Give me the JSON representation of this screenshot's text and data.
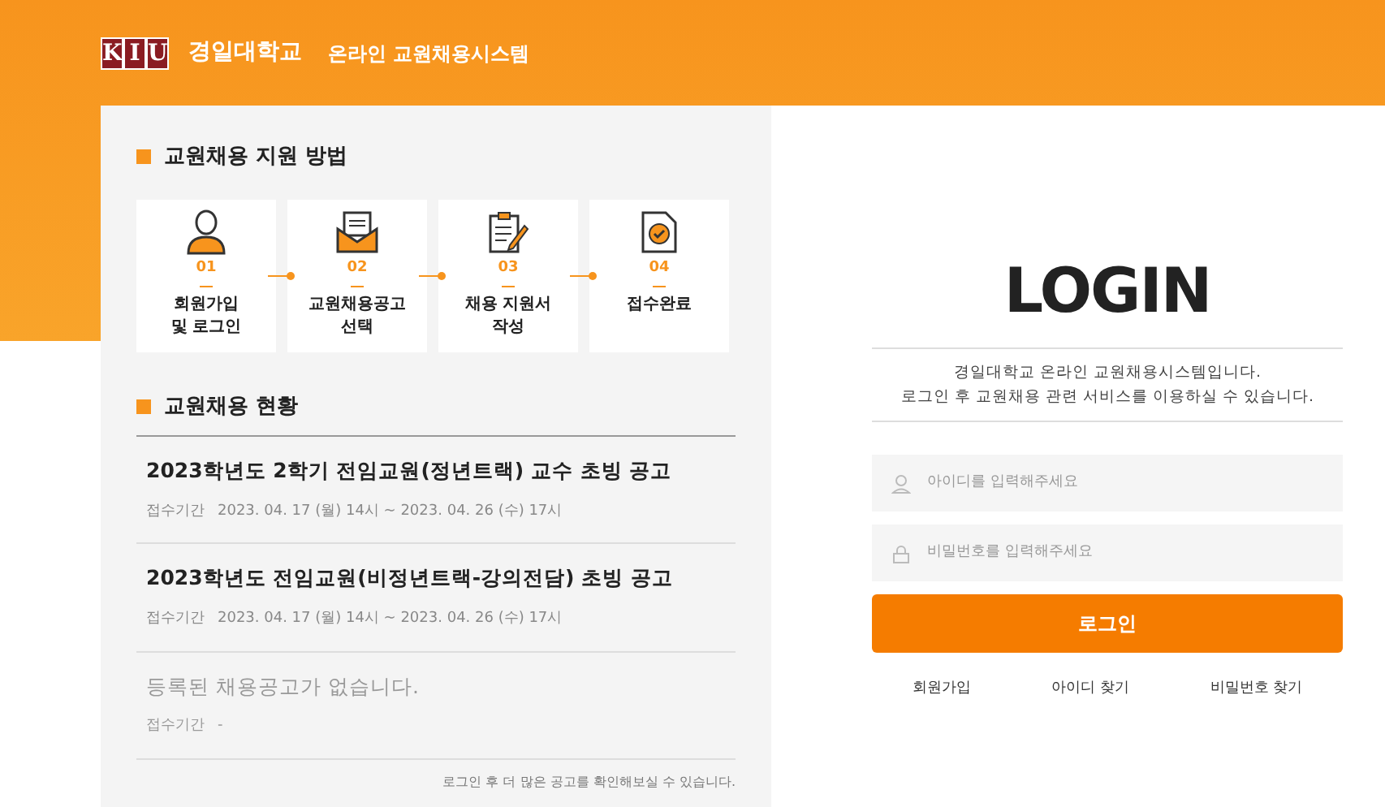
{
  "header": {
    "logo_letters": [
      "K",
      "I",
      "U"
    ],
    "university": "경일대학교",
    "system": "온라인 교원채용시스템"
  },
  "apply_steps": {
    "title": "교원채용 지원 방법",
    "steps": [
      {
        "kind": "person",
        "number": "01",
        "label": [
          "회원가입",
          "및 로그인"
        ]
      },
      {
        "kind": "envelope",
        "number": "02",
        "label": [
          "교원채용공고",
          "선택"
        ]
      },
      {
        "kind": "clipboard",
        "number": "03",
        "label": [
          "채용 지원서",
          "작성"
        ]
      },
      {
        "kind": "document",
        "number": "04",
        "label": [
          "접수완료"
        ]
      }
    ]
  },
  "status": {
    "title": "교원채용 현황",
    "notices": [
      {
        "title": "2023학년도 2학기 전임교원(정년트랙) 교수 초빙 공고",
        "period_label": "접수기간",
        "period": "2023. 04. 17 (월) 14시 ~ 2023. 04. 26 (수) 17시",
        "disabled": false
      },
      {
        "title": "2023학년도 전임교원(비정년트랙-강의전담) 초빙 공고",
        "period_label": "접수기간",
        "period": "2023. 04. 17 (월) 14시 ~ 2023. 04. 26 (수) 17시",
        "disabled": false
      },
      {
        "title": "등록된 채용공고가 없습니다.",
        "period_label": "접수기간",
        "period": "-",
        "disabled": true
      }
    ],
    "footnote": "로그인 후 더 많은 공고를 확인해보실 수 있습니다."
  },
  "login": {
    "title": "LOGIN",
    "description": [
      "경일대학교 온라인 교원채용시스템입니다.",
      "로그인 후 교원채용 관련 서비스를 이용하실 수 있습니다."
    ],
    "id_field": {
      "placeholder": "아이디를 입력해주세요"
    },
    "password_field": {
      "placeholder": "비밀번호를 입력해주세요"
    },
    "button": "로그인",
    "links": [
      "회원가입",
      "아이디 찾기",
      "비밀번호 찾기"
    ]
  }
}
